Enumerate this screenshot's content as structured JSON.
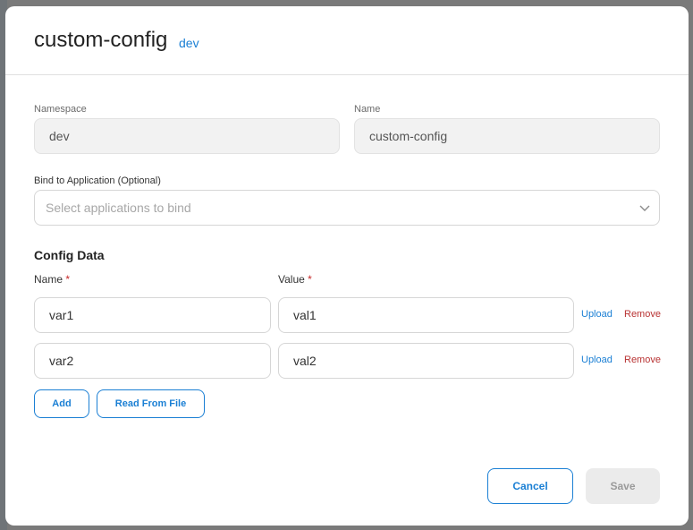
{
  "modal": {
    "title": "custom-config",
    "namespace_tag": "dev"
  },
  "form": {
    "namespace_label": "Namespace",
    "namespace_value": "dev",
    "name_label": "Name",
    "name_value": "custom-config",
    "bind_label": "Bind to Application (Optional)",
    "bind_placeholder": "Select applications to bind"
  },
  "config_data": {
    "title": "Config Data",
    "name_col": "Name",
    "value_col": "Value",
    "required_mark": "*",
    "rows": [
      {
        "name": "var1",
        "value": "val1",
        "upload": "Upload",
        "remove": "Remove"
      },
      {
        "name": "var2",
        "value": "val2",
        "upload": "Upload",
        "remove": "Remove"
      }
    ],
    "add_label": "Add",
    "read_file_label": "Read From File"
  },
  "footer": {
    "cancel_label": "Cancel",
    "save_label": "Save"
  },
  "colors": {
    "accent": "#1a7fd4",
    "danger": "#b83232",
    "disabled_bg": "#f2f2f2"
  }
}
